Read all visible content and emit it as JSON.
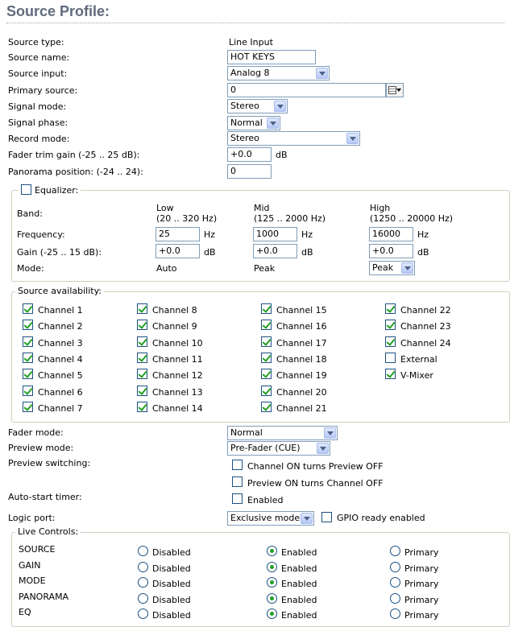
{
  "header": {
    "title": "Source Profile:"
  },
  "fields": {
    "source_type_label": "Source type:",
    "source_type_value": "Line Input",
    "source_name_label": "Source name:",
    "source_name_value": "HOT KEYS",
    "source_input_label": "Source input:",
    "source_input_value": "Analog 8",
    "primary_source_label": "Primary source:",
    "primary_source_value": "0",
    "signal_mode_label": "Signal mode:",
    "signal_mode_value": "Stereo",
    "signal_phase_label": "Signal phase:",
    "signal_phase_value": "Normal",
    "record_mode_label": "Record mode:",
    "record_mode_value": "Stereo",
    "fader_trim_label": "Fader trim gain (-25 .. 25 dB):",
    "fader_trim_value": "+0.0",
    "fader_trim_unit": "dB",
    "panorama_label": "Panorama position: (-24 .. 24):",
    "panorama_value": "0"
  },
  "equalizer": {
    "legend": "Equalizer:",
    "enabled": false,
    "band_label": "Band:",
    "frequency_label": "Frequency:",
    "gain_label": "Gain (-25 .. 15 dB):",
    "mode_label": "Mode:",
    "hz": "Hz",
    "db": "dB",
    "bands": [
      {
        "name": "Low",
        "range": "(20 .. 320 Hz)",
        "frequency": "25",
        "gain": "+0.0",
        "mode": "Auto"
      },
      {
        "name": "Mid",
        "range": "(125 .. 2000 Hz)",
        "frequency": "1000",
        "gain": "+0.0",
        "mode": "Peak"
      },
      {
        "name": "High",
        "range": "(1250 .. 20000 Hz)",
        "frequency": "16000",
        "gain": "+0.0",
        "mode": "Peak"
      }
    ]
  },
  "availability": {
    "legend": "Source availability:",
    "columns": [
      [
        {
          "label": "Channel 1",
          "checked": true
        },
        {
          "label": "Channel 2",
          "checked": true
        },
        {
          "label": "Channel 3",
          "checked": true
        },
        {
          "label": "Channel 4",
          "checked": true
        },
        {
          "label": "Channel 5",
          "checked": true
        },
        {
          "label": "Channel 6",
          "checked": true
        },
        {
          "label": "Channel 7",
          "checked": true
        }
      ],
      [
        {
          "label": "Channel 8",
          "checked": true
        },
        {
          "label": "Channel 9",
          "checked": true
        },
        {
          "label": "Channel 10",
          "checked": true
        },
        {
          "label": "Channel 11",
          "checked": true
        },
        {
          "label": "Channel 12",
          "checked": true
        },
        {
          "label": "Channel 13",
          "checked": true
        },
        {
          "label": "Channel 14",
          "checked": true
        }
      ],
      [
        {
          "label": "Channel 15",
          "checked": true
        },
        {
          "label": "Channel 16",
          "checked": true
        },
        {
          "label": "Channel 17",
          "checked": true
        },
        {
          "label": "Channel 18",
          "checked": true
        },
        {
          "label": "Channel 19",
          "checked": true
        },
        {
          "label": "Channel 20",
          "checked": true
        },
        {
          "label": "Channel 21",
          "checked": true
        }
      ],
      [
        {
          "label": "Channel 22",
          "checked": true
        },
        {
          "label": "Channel 23",
          "checked": true
        },
        {
          "label": "Channel 24",
          "checked": true
        },
        {
          "label": "External",
          "checked": false
        },
        {
          "label": "V-Mixer",
          "checked": true
        }
      ]
    ]
  },
  "lower": {
    "fader_mode_label": "Fader mode:",
    "fader_mode_value": "Normal",
    "preview_mode_label": "Preview mode:",
    "preview_mode_value": "Pre-Fader (CUE)",
    "preview_switching_label": "Preview switching:",
    "preview_opt1": "Channel ON turns Preview OFF",
    "preview_opt1_checked": false,
    "preview_opt2": "Preview ON turns Channel OFF",
    "preview_opt2_checked": false,
    "autostart_label": "Auto-start timer:",
    "autostart_opt": "Enabled",
    "autostart_checked": false,
    "logic_port_label": "Logic port:",
    "logic_port_value": "Exclusive mode",
    "gpio_label": "GPIO ready enabled",
    "gpio_checked": false
  },
  "live_controls": {
    "legend": "Live Controls:",
    "options": [
      "Disabled",
      "Enabled",
      "Primary"
    ],
    "rows": [
      {
        "name": "SOURCE",
        "selected": 1
      },
      {
        "name": "GAIN",
        "selected": 1
      },
      {
        "name": "MODE",
        "selected": 1
      },
      {
        "name": "PANORAMA",
        "selected": 1
      },
      {
        "name": "EQ",
        "selected": 1
      }
    ]
  }
}
